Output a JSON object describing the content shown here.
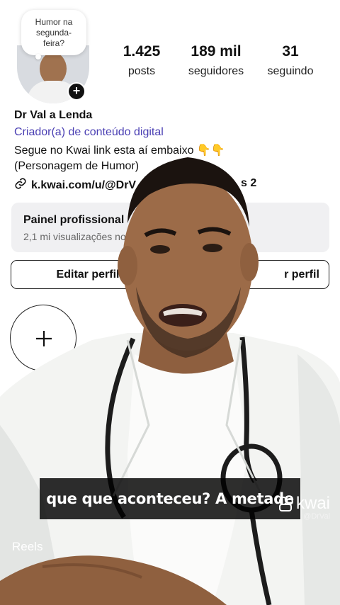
{
  "bubble": {
    "text": "Humor na segunda-feira?"
  },
  "stats": [
    {
      "value": "1.425",
      "label": "posts"
    },
    {
      "value": "189 mil",
      "label": "seguidores"
    },
    {
      "value": "31",
      "label": "seguindo"
    }
  ],
  "profile": {
    "name": "Dr Val a Lenda",
    "category": "Criador(a) de conteúdo digital",
    "bio_line1": "Segue no Kwai link esta aí embaixo 👇👇",
    "bio_line2": "(Personagem de Humor)",
    "link": "k.kwai.com/u/@DrV",
    "link_tail": "s 2"
  },
  "panel": {
    "title": "Painel profissional",
    "subtitle": "2,1 mi visualizações no"
  },
  "buttons": {
    "edit": "Editar perfil",
    "share": "r perfil"
  },
  "new_highlight": {
    "icon": "plus-icon"
  },
  "tabs": {
    "reels": "Reels"
  },
  "video": {
    "caption": "que que aconteceu? A metade",
    "watermark": "kwai",
    "handle": "@DrVal"
  },
  "colors": {
    "category": "#4a3fb3",
    "panel_bg": "#f0f0f2",
    "coat": "#f3f4f2",
    "skin": "#9c6b48"
  }
}
